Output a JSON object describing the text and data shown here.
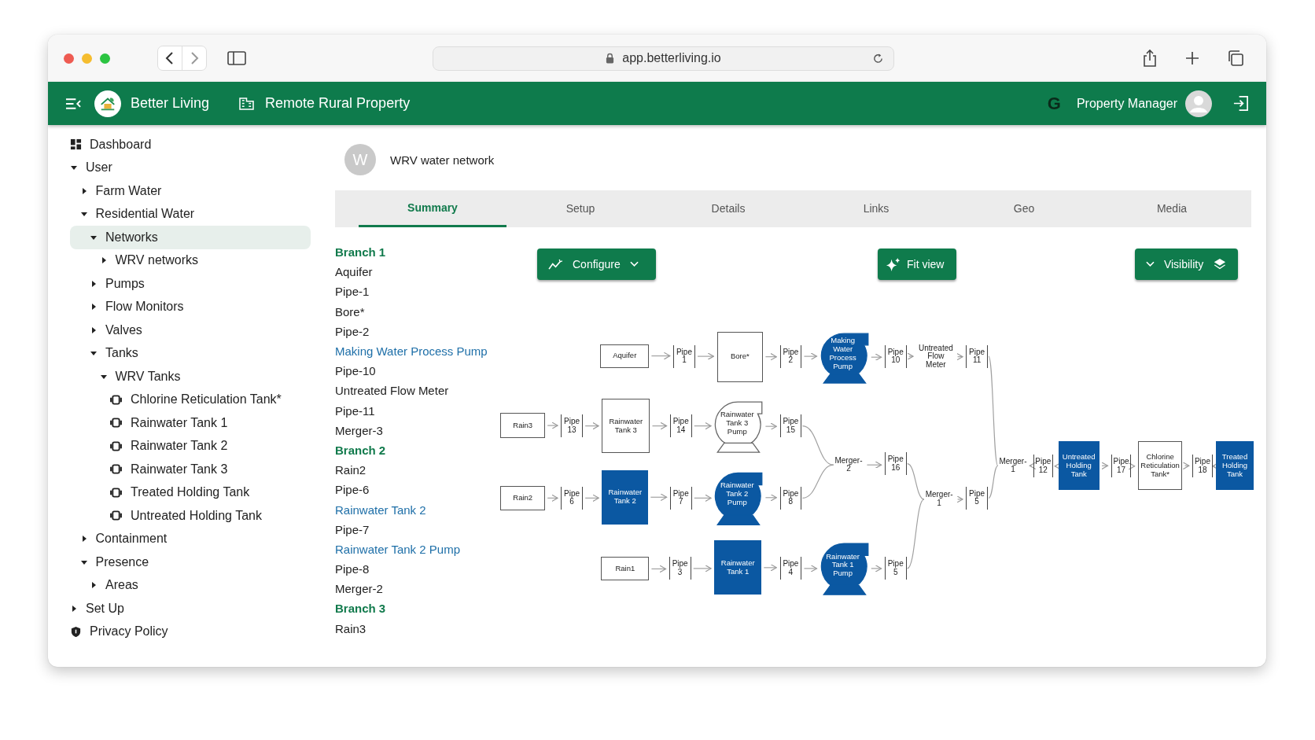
{
  "browser": {
    "url": "app.betterliving.io"
  },
  "header": {
    "brand": "Better Living",
    "property": "Remote Rural Property",
    "badge": "G",
    "user": "Property Manager"
  },
  "sidebar": {
    "items": [
      {
        "label": "Dashboard",
        "kind": "dashboard",
        "selected": false
      },
      {
        "label": "User",
        "kind": "folder",
        "expanded": true,
        "selected": false,
        "children": [
          {
            "label": "Farm Water",
            "kind": "folder",
            "expanded": false,
            "selected": false
          },
          {
            "label": "Residential Water",
            "kind": "folder",
            "expanded": true,
            "selected": false,
            "children": [
              {
                "label": "Networks",
                "kind": "folder",
                "expanded": true,
                "selected": true,
                "children": [
                  {
                    "label": "WRV networks",
                    "kind": "folder",
                    "expanded": false,
                    "selected": false
                  }
                ]
              },
              {
                "label": "Pumps",
                "kind": "folder",
                "expanded": false,
                "selected": false
              },
              {
                "label": "Flow Monitors",
                "kind": "folder",
                "expanded": false,
                "selected": false
              },
              {
                "label": "Valves",
                "kind": "folder",
                "expanded": false,
                "selected": false
              },
              {
                "label": "Tanks",
                "kind": "folder",
                "expanded": true,
                "selected": false,
                "children": [
                  {
                    "label": "WRV Tanks",
                    "kind": "folder",
                    "expanded": true,
                    "selected": false,
                    "children": [
                      {
                        "label": "Chlorine Reticulation Tank*",
                        "kind": "tank",
                        "selected": false
                      },
                      {
                        "label": "Rainwater Tank 1",
                        "kind": "tank",
                        "selected": false
                      },
                      {
                        "label": "Rainwater Tank 2",
                        "kind": "tank",
                        "selected": false
                      },
                      {
                        "label": "Rainwater Tank 3",
                        "kind": "tank",
                        "selected": false
                      },
                      {
                        "label": "Treated Holding Tank",
                        "kind": "tank",
                        "selected": false
                      },
                      {
                        "label": "Untreated Holding Tank",
                        "kind": "tank",
                        "selected": false
                      }
                    ]
                  }
                ]
              }
            ]
          },
          {
            "label": "Containment",
            "kind": "folder",
            "expanded": false,
            "selected": false
          },
          {
            "label": "Presence",
            "kind": "folder",
            "expanded": true,
            "selected": false,
            "children": [
              {
                "label": "Areas",
                "kind": "folder",
                "expanded": false,
                "selected": false
              }
            ]
          }
        ]
      },
      {
        "label": "Set Up",
        "kind": "folder",
        "expanded": false,
        "selected": false
      },
      {
        "label": "Privacy Policy",
        "kind": "shield",
        "selected": false
      }
    ]
  },
  "network": {
    "avatar": "W",
    "title": "WRV water network"
  },
  "tabs": [
    {
      "label": "Summary",
      "selected": true
    },
    {
      "label": "Setup",
      "selected": false
    },
    {
      "label": "Details",
      "selected": false
    },
    {
      "label": "Links",
      "selected": false
    },
    {
      "label": "Geo",
      "selected": false
    },
    {
      "label": "Media",
      "selected": false
    }
  ],
  "summary": [
    {
      "text": "Branch 1",
      "kind": "branch"
    },
    {
      "text": "Aquifer",
      "kind": "item"
    },
    {
      "text": "Pipe-1",
      "kind": "item"
    },
    {
      "text": "Bore*",
      "kind": "item"
    },
    {
      "text": "Pipe-2",
      "kind": "item"
    },
    {
      "text": "Making Water Process Pump",
      "kind": "link"
    },
    {
      "text": "Pipe-10",
      "kind": "item"
    },
    {
      "text": "Untreated Flow Meter",
      "kind": "item"
    },
    {
      "text": "Pipe-11",
      "kind": "item"
    },
    {
      "text": "Merger-3",
      "kind": "item"
    },
    {
      "text": "Branch 2",
      "kind": "branch"
    },
    {
      "text": "Rain2",
      "kind": "item"
    },
    {
      "text": "Pipe-6",
      "kind": "item"
    },
    {
      "text": "Rainwater Tank 2",
      "kind": "link"
    },
    {
      "text": "Pipe-7",
      "kind": "item"
    },
    {
      "text": "Rainwater Tank 2 Pump",
      "kind": "link"
    },
    {
      "text": "Pipe-8",
      "kind": "item"
    },
    {
      "text": "Merger-2",
      "kind": "item"
    },
    {
      "text": "Branch 3",
      "kind": "branch"
    },
    {
      "text": "Rain3",
      "kind": "item"
    }
  ],
  "toolbar": {
    "buttons": [
      {
        "label": "Configure",
        "kind": "configure"
      },
      {
        "label": "Fit view",
        "kind": "fit"
      },
      {
        "label": "Visibility",
        "kind": "visibility"
      }
    ]
  },
  "diagram": {
    "nodes": [
      {
        "label": "Aquifer",
        "kind": "box",
        "highlighted": false
      },
      {
        "label": "Pipe 1",
        "kind": "pipe",
        "highlighted": false
      },
      {
        "label": "Bore*",
        "kind": "tank",
        "highlighted": false
      },
      {
        "label": "Pipe 2",
        "kind": "pipe",
        "highlighted": false
      },
      {
        "label": "Making Water Process Pump",
        "kind": "pump",
        "highlighted": true
      },
      {
        "label": "Pipe 10",
        "kind": "pipe",
        "highlighted": false
      },
      {
        "label": "Untreated Flow Meter",
        "kind": "meter",
        "highlighted": false
      },
      {
        "label": "Pipe 11",
        "kind": "pipe",
        "highlighted": false
      },
      {
        "label": "Rain3",
        "kind": "box",
        "highlighted": false
      },
      {
        "label": "Pipe 13",
        "kind": "pipe",
        "highlighted": false
      },
      {
        "label": "Rainwater Tank 3",
        "kind": "tank",
        "highlighted": false
      },
      {
        "label": "Pipe 14",
        "kind": "pipe",
        "highlighted": false
      },
      {
        "label": "Rainwater Tank 3 Pump",
        "kind": "pump",
        "highlighted": false
      },
      {
        "label": "Pipe 15",
        "kind": "pipe",
        "highlighted": false
      },
      {
        "label": "Merger-2",
        "kind": "merger",
        "highlighted": false
      },
      {
        "label": "Pipe 16",
        "kind": "pipe",
        "highlighted": false
      },
      {
        "label": "Merger-1",
        "kind": "merger",
        "highlighted": false
      },
      {
        "label": "Pipe 12",
        "kind": "pipe",
        "highlighted": false
      },
      {
        "label": "Untreated Holding Tank",
        "kind": "tank",
        "highlighted": true
      },
      {
        "label": "Pipe 17",
        "kind": "pipe",
        "highlighted": false
      },
      {
        "label": "Chlorine Reticulation Tank*",
        "kind": "tank",
        "highlighted": false
      },
      {
        "label": "Pipe 18",
        "kind": "pipe",
        "highlighted": false
      },
      {
        "label": "Treated Holding Tank",
        "kind": "tank",
        "highlighted": true
      },
      {
        "label": "Rain2",
        "kind": "box",
        "highlighted": false
      },
      {
        "label": "Pipe 6",
        "kind": "pipe",
        "highlighted": false
      },
      {
        "label": "Rainwater Tank 2",
        "kind": "tank",
        "highlighted": true
      },
      {
        "label": "Pipe 7",
        "kind": "pipe",
        "highlighted": false
      },
      {
        "label": "Rainwater Tank 2 Pump",
        "kind": "pump",
        "highlighted": true
      },
      {
        "label": "Pipe 8",
        "kind": "pipe",
        "highlighted": false
      },
      {
        "label": "Merger-1",
        "kind": "merger",
        "highlighted": false
      },
      {
        "label": "Pipe 5",
        "kind": "pipe",
        "highlighted": false
      },
      {
        "label": "Rain1",
        "kind": "box",
        "highlighted": false
      },
      {
        "label": "Pipe 3",
        "kind": "pipe",
        "highlighted": false
      },
      {
        "label": "Rainwater Tank 1",
        "kind": "tank",
        "highlighted": true
      },
      {
        "label": "Pipe 4",
        "kind": "pipe",
        "highlighted": false
      },
      {
        "label": "Rainwater Tank 1 Pump",
        "kind": "pump",
        "highlighted": true
      },
      {
        "label": "Pipe 5",
        "kind": "pipe",
        "highlighted": false
      }
    ]
  }
}
